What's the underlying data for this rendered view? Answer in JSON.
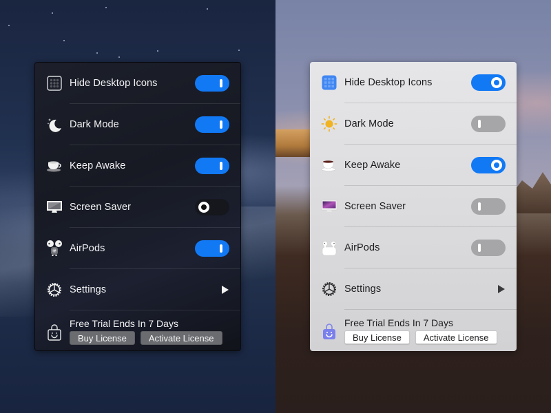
{
  "themes": {
    "dark": {
      "accent": "#1279F5",
      "items": [
        {
          "label": "Hide Desktop Icons",
          "icon": "grid-icon",
          "toggle": true,
          "state": "on"
        },
        {
          "label": "Dark Mode",
          "icon": "moon-icon",
          "toggle": true,
          "state": "on"
        },
        {
          "label": "Keep Awake",
          "icon": "coffee-cup-icon",
          "toggle": true,
          "state": "on"
        },
        {
          "label": "Screen Saver",
          "icon": "monitor-icon",
          "toggle": true,
          "state": "off"
        },
        {
          "label": "AirPods",
          "icon": "airpods-icon",
          "toggle": true,
          "state": "on"
        },
        {
          "label": "Settings",
          "icon": "gear-icon",
          "toggle": false,
          "submenu_icon": "triangle-right-icon"
        }
      ],
      "footer": {
        "trial_text": "Free Trial Ends In 7 Days",
        "icon": "shopping-bag-icon",
        "buy_label": "Buy License",
        "activate_label": "Activate License"
      }
    },
    "light": {
      "accent": "#1279F5",
      "items": [
        {
          "label": "Hide Desktop Icons",
          "icon": "grid-icon",
          "toggle": true,
          "state": "on"
        },
        {
          "label": "Dark Mode",
          "icon": "sun-icon",
          "toggle": true,
          "state": "off"
        },
        {
          "label": "Keep Awake",
          "icon": "coffee-cup-icon",
          "toggle": true,
          "state": "on"
        },
        {
          "label": "Screen Saver",
          "icon": "monitor-icon",
          "toggle": true,
          "state": "off"
        },
        {
          "label": "AirPods",
          "icon": "airpods-icon",
          "toggle": true,
          "state": "off"
        },
        {
          "label": "Settings",
          "icon": "gear-icon",
          "toggle": false,
          "submenu_icon": "triangle-right-icon"
        }
      ],
      "footer": {
        "trial_text": "Free Trial Ends In 7 Days",
        "icon": "shopping-bag-icon",
        "buy_label": "Buy License",
        "activate_label": "Activate License"
      }
    }
  }
}
